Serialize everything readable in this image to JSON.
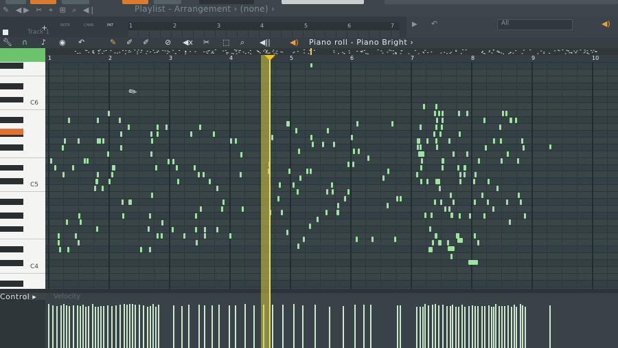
{
  "playlist": {
    "title": "Playlist - Arrangement › (none) ›",
    "track_label": "Track 1",
    "ruler_numbers": [
      "1",
      "2",
      "3",
      "4",
      "5",
      "6",
      "7"
    ],
    "mini_labels": [
      "NOTE",
      "CHAN",
      "PAT"
    ],
    "filter_value": "All"
  },
  "piano_roll": {
    "title": "Piano roll - Piano Bright ›",
    "ruler_numbers": [
      "1",
      "2",
      "3",
      "4",
      "5",
      "6",
      "7",
      "8",
      "9",
      "10"
    ],
    "key_labels": [
      "C6",
      "C5",
      "C4"
    ],
    "tool_icons": [
      "wrench-icon",
      "magnet-icon",
      "note-icon",
      "record-icon",
      "undo-icon",
      "pencil-icon",
      "paint-icon",
      "delete-icon",
      "mute-icon",
      "slice-icon",
      "select-icon",
      "zoom-icon",
      "playback-icon"
    ],
    "control_label": "Control ▸",
    "event_label": "Velocity"
  },
  "colors": {
    "note": "#9fe3a0",
    "playhead": "#f0e060",
    "accent": "#e07a2a"
  }
}
